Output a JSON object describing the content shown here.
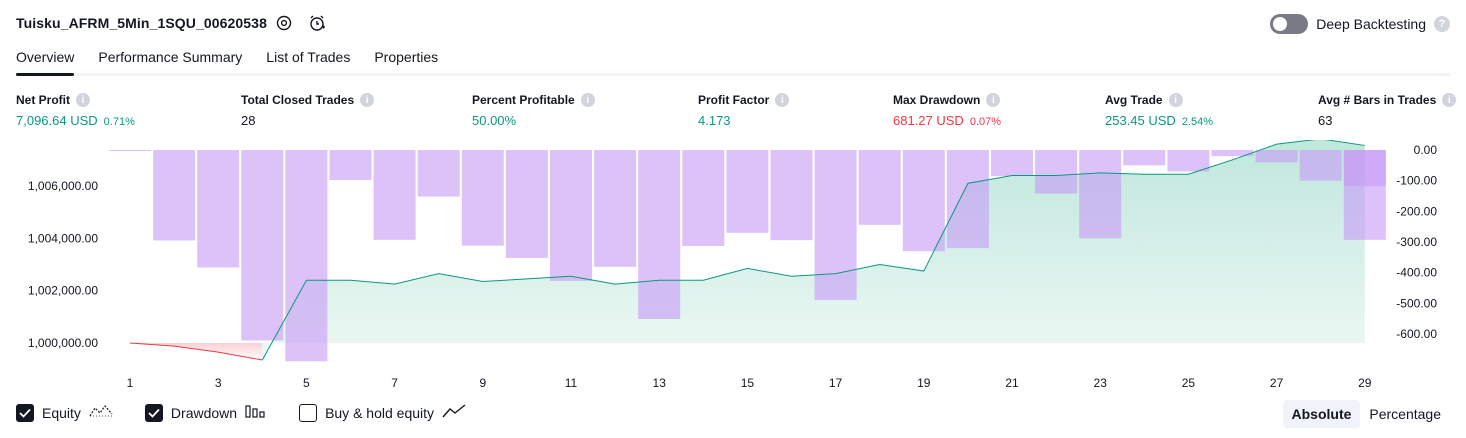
{
  "header": {
    "title": "Tuisku_AFRM_5Min_1SQU_00620538",
    "icons": [
      "settings-icon",
      "alert-clock-icon"
    ],
    "deep_backtesting_label": "Deep Backtesting",
    "deep_backtesting_enabled": false
  },
  "tabs": [
    {
      "label": "Overview",
      "active": true
    },
    {
      "label": "Performance Summary",
      "active": false
    },
    {
      "label": "List of Trades",
      "active": false
    },
    {
      "label": "Properties",
      "active": false
    }
  ],
  "stats": [
    {
      "label": "Net Profit",
      "value": "7,096.64 USD",
      "pct": "0.71%",
      "color": "#089981"
    },
    {
      "label": "Total Closed Trades",
      "value": "28",
      "pct": "",
      "color": "#131722"
    },
    {
      "label": "Percent Profitable",
      "value": "50.00%",
      "pct": "",
      "color": "#089981"
    },
    {
      "label": "Profit Factor",
      "value": "4.173",
      "pct": "",
      "color": "#089981"
    },
    {
      "label": "Max Drawdown",
      "value": "681.27 USD",
      "pct": "0.07%",
      "color": "#f23645"
    },
    {
      "label": "Avg Trade",
      "value": "253.45 USD",
      "pct": "2.54%",
      "color": "#089981"
    },
    {
      "label": "Avg # Bars in Trades",
      "value": "63",
      "pct": "",
      "color": "#131722"
    }
  ],
  "legend": {
    "equity": {
      "label": "Equity",
      "checked": true,
      "icon": "equity-line-icon"
    },
    "drawdown": {
      "label": "Drawdown",
      "checked": true,
      "icon": "drawdown-bars-icon"
    },
    "buyhold": {
      "label": "Buy & hold equity",
      "checked": false,
      "icon": "buyhold-line-icon"
    }
  },
  "mode": {
    "absolute": "Absolute",
    "percentage": "Percentage",
    "selected": "absolute"
  },
  "colors": {
    "equity_up": "#089981",
    "equity_down": "#f23645",
    "drawdown_bar": "#d9b8fb",
    "equity_fill": "#d5efe9"
  },
  "chart_data": {
    "type": "bar",
    "x_ticks": [
      "1",
      "3",
      "5",
      "7",
      "9",
      "11",
      "13",
      "15",
      "17",
      "19",
      "21",
      "23",
      "25",
      "27",
      "29"
    ],
    "left_axis": {
      "ticks": [
        "1,000,000.00",
        "1,002,000.00",
        "1,004,000.00",
        "1,006,000.00"
      ],
      "range": [
        999200,
        1006800
      ]
    },
    "right_axis": {
      "ticks": [
        "0.00",
        "-100.00",
        "-200.00",
        "-300.00",
        "-400.00",
        "-500.00",
        "-600.00"
      ],
      "range": [
        -680,
        0
      ]
    },
    "series": [
      {
        "name": "Equity",
        "x": [
          1,
          2,
          3,
          4,
          5,
          6,
          7,
          8,
          9,
          10,
          11,
          12,
          13,
          14,
          15,
          16,
          17,
          18,
          19,
          20,
          21,
          22,
          23,
          24,
          25,
          26,
          27,
          28,
          29
        ],
        "values": [
          1000000,
          999880,
          999650,
          999350,
          1002400,
          1002400,
          1002250,
          1002650,
          1002350,
          1002450,
          1002550,
          1002250,
          1002400,
          1002400,
          1002850,
          1002550,
          1002650,
          1003000,
          1002750,
          1006100,
          1006400,
          1006400,
          1006500,
          1006450,
          1006450,
          1007000,
          1007600,
          1007800,
          1007550
        ]
      },
      {
        "name": "Drawdown",
        "x": [
          1,
          2,
          3,
          4,
          5,
          6,
          7,
          8,
          9,
          10,
          11,
          12,
          13,
          14,
          15,
          16,
          17,
          18,
          19,
          20,
          21,
          22,
          23,
          24,
          25,
          26,
          27,
          28,
          29
        ],
        "values": [
          -1,
          -295,
          -383,
          -621,
          -689,
          -98,
          -293,
          -152,
          -312,
          -352,
          -427,
          -381,
          -551,
          -313,
          -270,
          -294,
          -489,
          -244,
          -330,
          -320,
          -85,
          -142,
          -288,
          -50,
          -70,
          -20,
          -40,
          -100,
          -118
        ]
      }
    ],
    "drawdown_last_bar": -293
  }
}
